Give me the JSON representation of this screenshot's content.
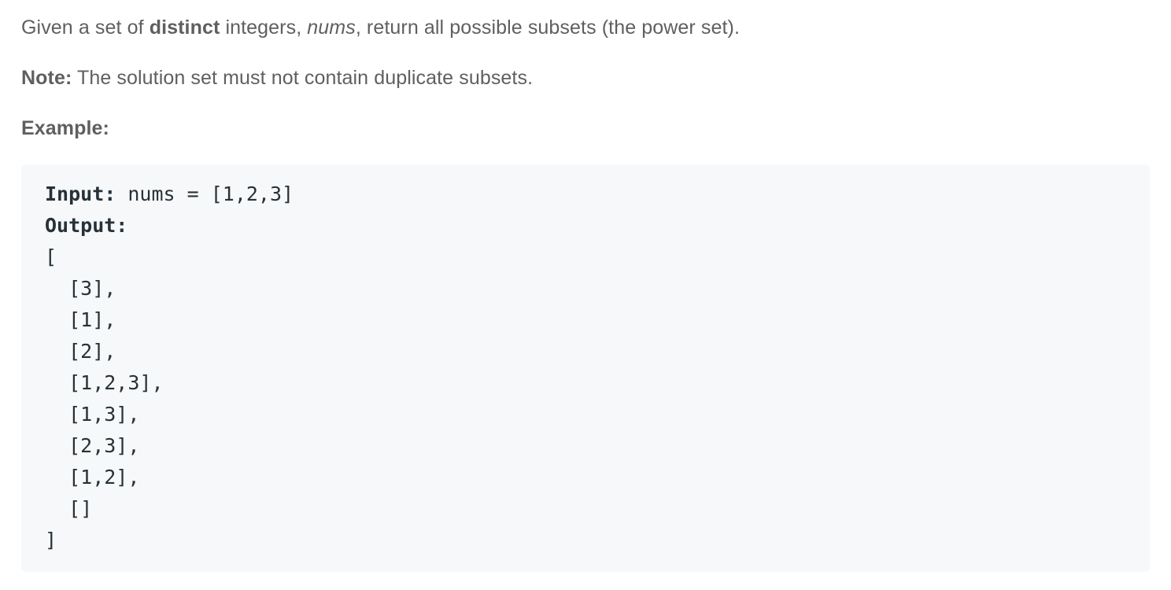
{
  "description": {
    "p1_a": "Given a set of ",
    "p1_bold": "distinct",
    "p1_b": " integers, ",
    "p1_italic": "nums",
    "p1_c": ", return all possible subsets (the power set).",
    "note_label": "Note:",
    "note_text": " The solution set must not contain duplicate subsets.",
    "example_label": "Example:"
  },
  "example": {
    "input_label": "Input:",
    "input_value": " nums = [1,2,3]",
    "output_label": "Output:",
    "output_lines": [
      "[",
      "  [3],",
      "  [1],",
      "  [2],",
      "  [1,2,3],",
      "  [1,3],",
      "  [2,3],",
      "  [1,2],",
      "  []",
      "]"
    ]
  },
  "colors": {
    "text": "#5f5f5f",
    "code_text": "#263238",
    "code_bg": "#f7f8fa"
  }
}
